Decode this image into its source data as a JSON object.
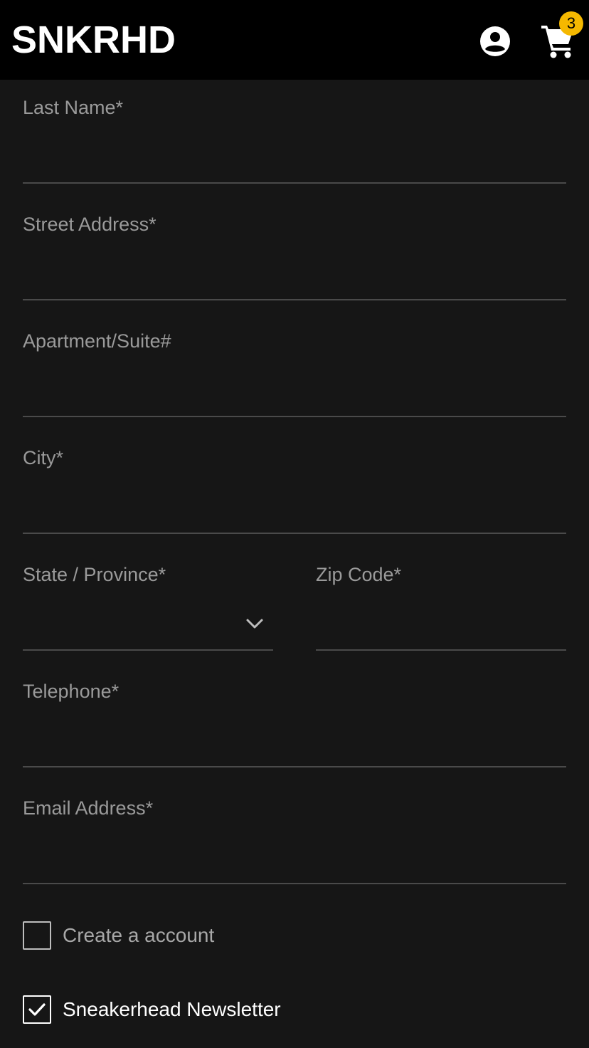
{
  "header": {
    "logo": "SNKRHD",
    "account_icon": "account-circle-icon",
    "cart_icon": "shopping-cart-icon",
    "cart_count": "3",
    "badge_color": "#f5b800"
  },
  "form": {
    "last_name": {
      "label": "Last Name*",
      "value": ""
    },
    "street_address": {
      "label": "Street Address*",
      "value": ""
    },
    "apartment": {
      "label": "Apartment/Suite#",
      "value": ""
    },
    "city": {
      "label": "City*",
      "value": ""
    },
    "state": {
      "label": "State / Province*",
      "value": "",
      "icon": "chevron-down-icon"
    },
    "zip": {
      "label": "Zip Code*",
      "value": ""
    },
    "telephone": {
      "label": "Telephone*",
      "value": ""
    },
    "email": {
      "label": "Email Address*",
      "value": ""
    }
  },
  "options": {
    "create_account": {
      "label": "Create a account",
      "checked": false
    },
    "newsletter": {
      "label": "Sneakerhead Newsletter",
      "checked": true
    }
  }
}
